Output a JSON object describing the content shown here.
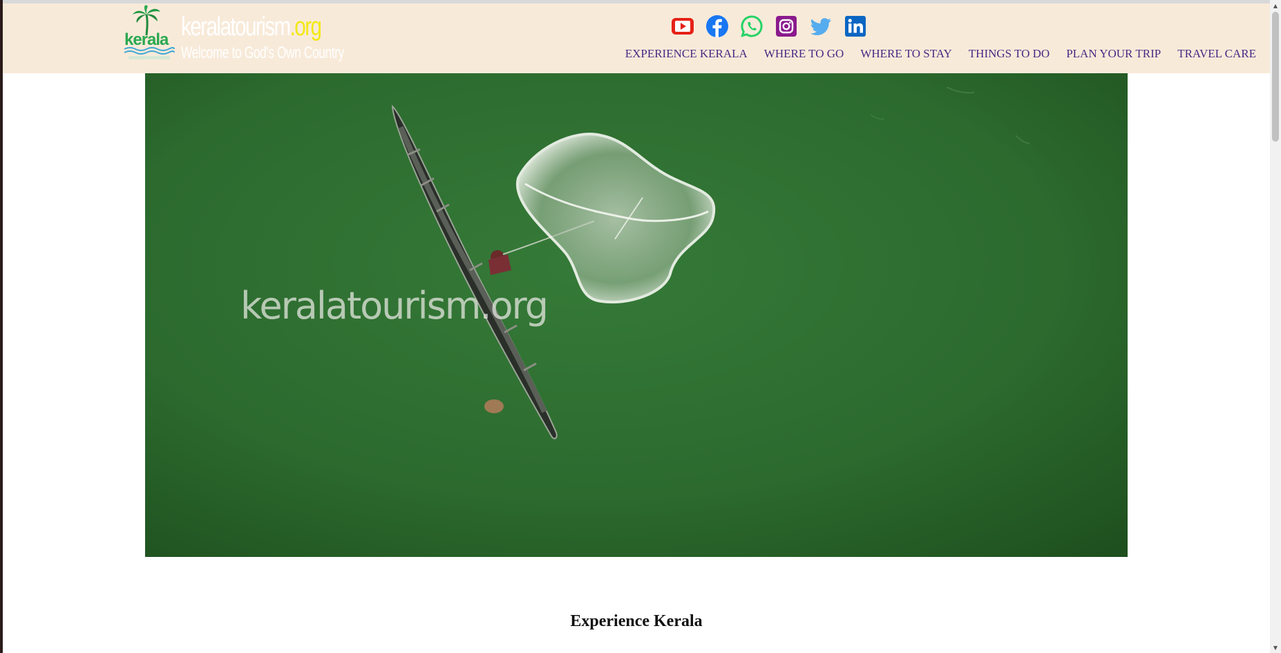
{
  "brand": {
    "logo_text": "kerala",
    "name_main": "keralatourism",
    "name_tld": ".org",
    "tagline": "Welcome to God's Own Country"
  },
  "socials": [
    {
      "name": "youtube-icon",
      "color": "#e62117"
    },
    {
      "name": "facebook-icon",
      "color": "#1877f2"
    },
    {
      "name": "whatsapp-icon",
      "color": "#25d366"
    },
    {
      "name": "instagram-icon",
      "color": "#8a1a8c"
    },
    {
      "name": "twitter-icon",
      "color": "#55acee"
    },
    {
      "name": "linkedin-icon",
      "color": "#0a66c2"
    }
  ],
  "nav": {
    "items": [
      {
        "label": "EXPERIENCE KERALA"
      },
      {
        "label": "WHERE TO GO"
      },
      {
        "label": "WHERE TO STAY"
      },
      {
        "label": "THINGS TO DO"
      },
      {
        "label": "PLAN YOUR TRIP"
      },
      {
        "label": "TRAVEL CARE"
      }
    ]
  },
  "hero": {
    "watermark": "keralatourism.org",
    "water_color": "#2f6b30"
  },
  "main": {
    "section_title": "Experience Kerala"
  },
  "colors": {
    "header_bg": "#f8ead9",
    "nav_text": "#4b2885",
    "tld_yellow": "#f3e814"
  }
}
